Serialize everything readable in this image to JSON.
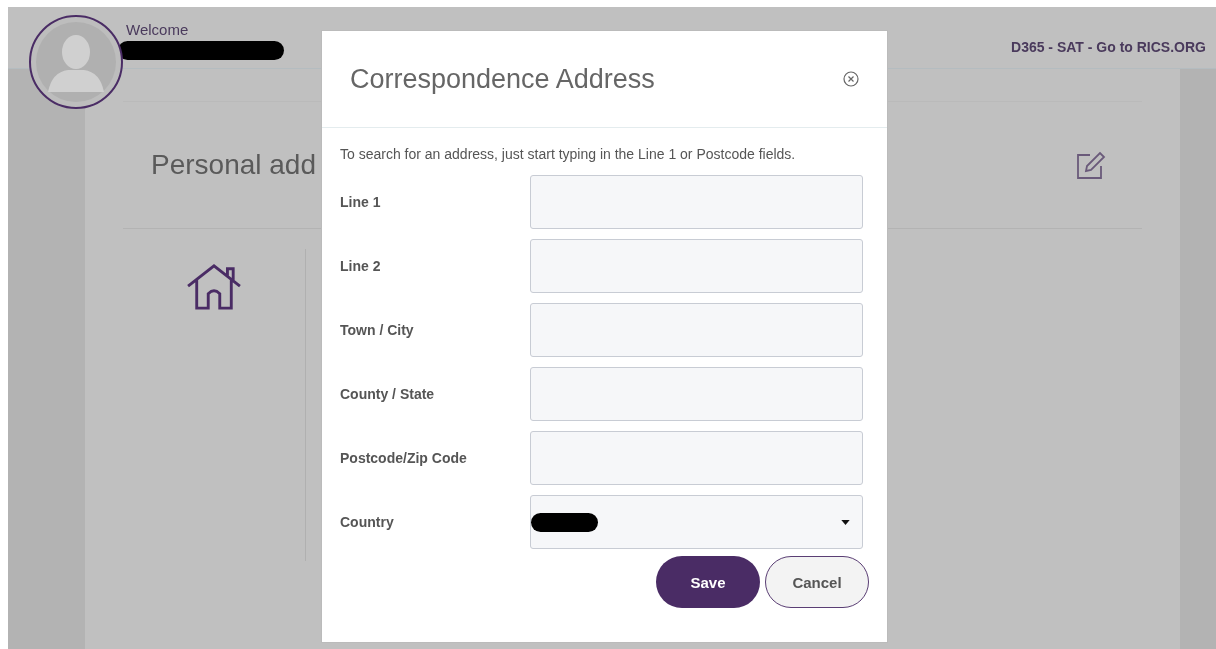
{
  "header": {
    "welcome": "Welcome",
    "link": "D365 - SAT - Go to RICS.ORG"
  },
  "section": {
    "title": "Personal add"
  },
  "dialog": {
    "title": "Correspondence Address",
    "hint": "To search for an address, just start typing in the Line 1 or Postcode fields.",
    "fields": [
      {
        "label": "Line 1",
        "kind": "text"
      },
      {
        "label": "Line 2",
        "kind": "text"
      },
      {
        "label": "Town / City",
        "kind": "text"
      },
      {
        "label": "County / State",
        "kind": "text"
      },
      {
        "label": "Postcode/Zip Code",
        "kind": "text"
      },
      {
        "label": "Country",
        "kind": "select"
      }
    ],
    "buttons": [
      {
        "label": "Save",
        "kind": "primary"
      },
      {
        "label": "Cancel",
        "kind": "secondary"
      }
    ]
  }
}
